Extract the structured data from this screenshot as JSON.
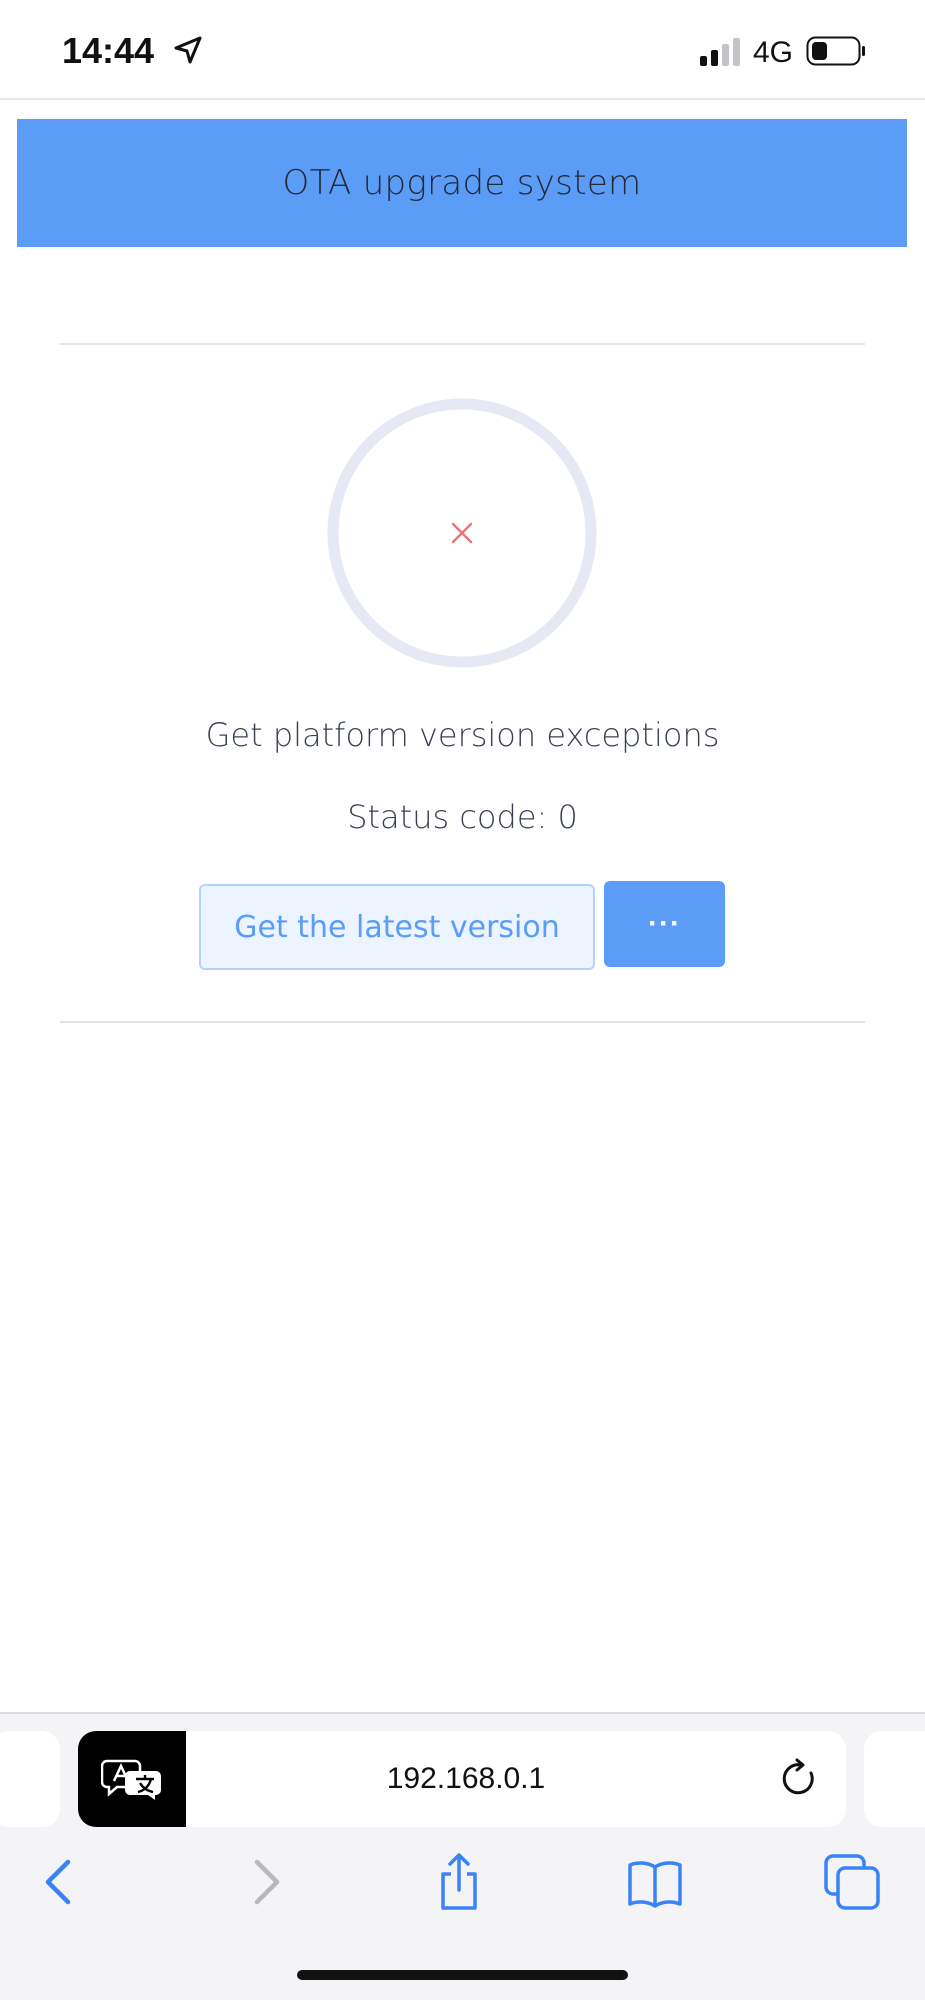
{
  "status_bar": {
    "time": "14:44",
    "network": "4G",
    "icons": [
      "location-arrow-icon",
      "cellular-signal-icon",
      "battery-icon"
    ]
  },
  "header": {
    "title": "OTA upgrade system"
  },
  "result": {
    "icon": "error-x-icon",
    "message": "Get platform version exceptions",
    "status_code": "Status code: 0"
  },
  "actions": {
    "latest_version_label": "Get the latest version",
    "more_label": "···"
  },
  "browser": {
    "url": "192.168.0.1",
    "toolbar": [
      "back-icon",
      "forward-icon",
      "share-icon",
      "bookmarks-icon",
      "tabs-icon"
    ]
  },
  "colors": {
    "accent": "#5b9cf7",
    "error": "#e8767a",
    "ring": "#e6e9f3"
  }
}
